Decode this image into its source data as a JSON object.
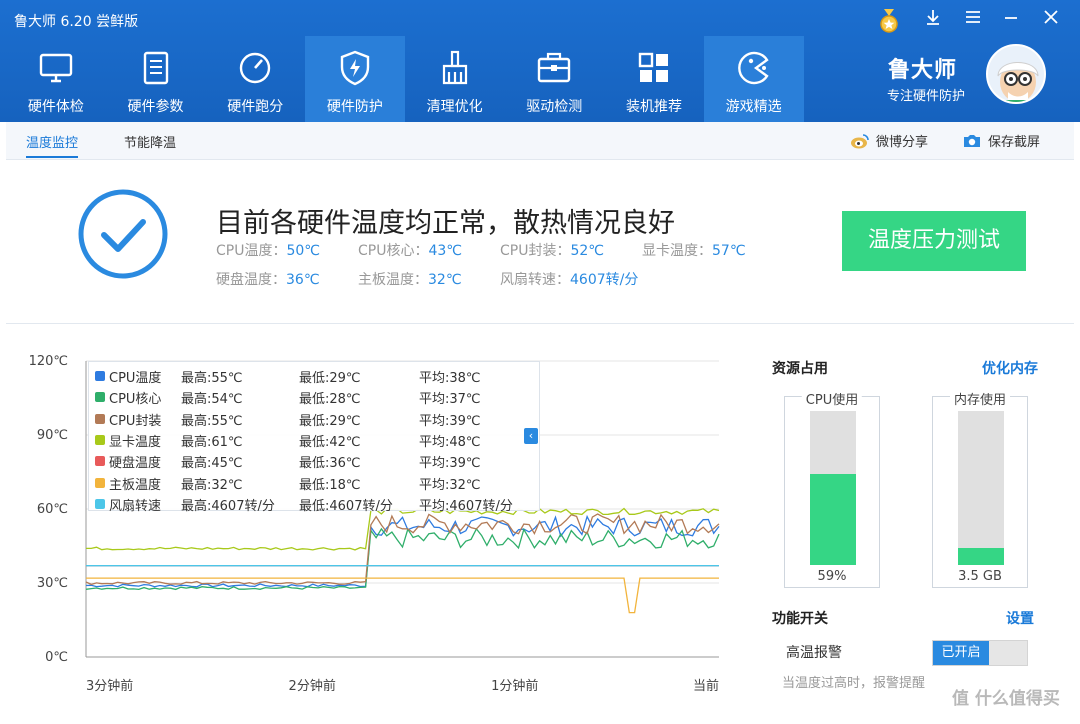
{
  "app": {
    "title": "鲁大师 6.20 尝鲜版"
  },
  "window_controls": {
    "medal_icon": "medal-icon",
    "download_icon": "download-icon",
    "menu_icon": "menu-icon",
    "minimize_icon": "minimize-icon",
    "close_icon": "close-icon"
  },
  "nav": {
    "items": [
      {
        "label": "硬件体检",
        "icon": "monitor-icon"
      },
      {
        "label": "硬件参数",
        "icon": "document-icon"
      },
      {
        "label": "硬件跑分",
        "icon": "gauge-icon"
      },
      {
        "label": "硬件防护",
        "icon": "shield-icon",
        "active": true
      },
      {
        "label": "清理优化",
        "icon": "broom-icon"
      },
      {
        "label": "驱动检测",
        "icon": "toolbox-icon"
      },
      {
        "label": "装机推荐",
        "icon": "grid-icon"
      },
      {
        "label": "游戏精选",
        "icon": "gamepad-icon"
      }
    ]
  },
  "brand": {
    "name": "鲁大师",
    "slogan": "专注硬件防护"
  },
  "subtabs": [
    {
      "label": "温度监控",
      "active": true
    },
    {
      "label": "节能降温"
    }
  ],
  "actions": {
    "weibo_share": "微博分享",
    "save_screenshot": "保存截屏"
  },
  "status": {
    "headline": "目前各硬件温度均正常，散热情况良好",
    "temps": [
      {
        "label": "CPU温度：",
        "value": "50℃"
      },
      {
        "label": "CPU核心：",
        "value": "43℃"
      },
      {
        "label": "CPU封装：",
        "value": "52℃"
      },
      {
        "label": "显卡温度：",
        "value": "57℃"
      },
      {
        "label": "硬盘温度：",
        "value": "36℃"
      },
      {
        "label": "主板温度：",
        "value": "32℃"
      },
      {
        "label": "风扇转速：",
        "value": "4607转/分"
      }
    ],
    "stress_test_button": "温度压力测试"
  },
  "chart_data": {
    "type": "line",
    "ylim": [
      0,
      120
    ],
    "y_ticks": [
      "120℃",
      "90℃",
      "60℃",
      "30℃",
      "0℃"
    ],
    "x_ticks": [
      "3分钟前",
      "2分钟前",
      "1分钟前",
      "当前"
    ],
    "grid": true,
    "legend_placement": "top-left",
    "series": [
      {
        "name": "CPU温度",
        "color": "#2e7be0",
        "max": "最高:55℃",
        "min": "最低:29℃",
        "avg": "平均:38℃",
        "start": 29,
        "end": 53
      },
      {
        "name": "CPU核心",
        "color": "#2fae6a",
        "max": "最高:54℃",
        "min": "最低:28℃",
        "avg": "平均:37℃",
        "start": 28,
        "end": 48
      },
      {
        "name": "CPU封装",
        "color": "#b27a56",
        "max": "最高:55℃",
        "min": "最低:29℃",
        "avg": "平均:39℃",
        "start": 30,
        "end": 54
      },
      {
        "name": "显卡温度",
        "color": "#a8c91a",
        "max": "最高:61℃",
        "min": "最低:42℃",
        "avg": "平均:48℃",
        "start": 44,
        "end": 59
      },
      {
        "name": "硬盘温度",
        "color": "#e85a5a",
        "max": "最高:45℃",
        "min": "最低:36℃",
        "avg": "平均:39℃",
        "start": 37,
        "end": 37
      },
      {
        "name": "主板温度",
        "color": "#f2b43c",
        "max": "最高:32℃",
        "min": "最低:18℃",
        "avg": "平均:32℃",
        "start": 32,
        "end": 32
      },
      {
        "name": "风扇转速",
        "color": "#4cc6e8",
        "max": "最高:4607转/分",
        "min": "最低:4607转/分",
        "avg": "平均:4607转/分",
        "start": 37,
        "end": 37
      }
    ]
  },
  "resources": {
    "title": "资源占用",
    "optimize_link": "优化内存",
    "cpu": {
      "title": "CPU使用",
      "value": "59%",
      "fraction": 0.59
    },
    "memory": {
      "title": "内存使用",
      "value": "3.5 GB",
      "fraction": 0.11
    }
  },
  "features": {
    "title": "功能开关",
    "settings_link": "设置",
    "alarm_label": "高温报警",
    "alarm_state": "已开启",
    "alarm_hint": "当温度过高时，报警提醒"
  },
  "watermark": "值 什么值得买"
}
